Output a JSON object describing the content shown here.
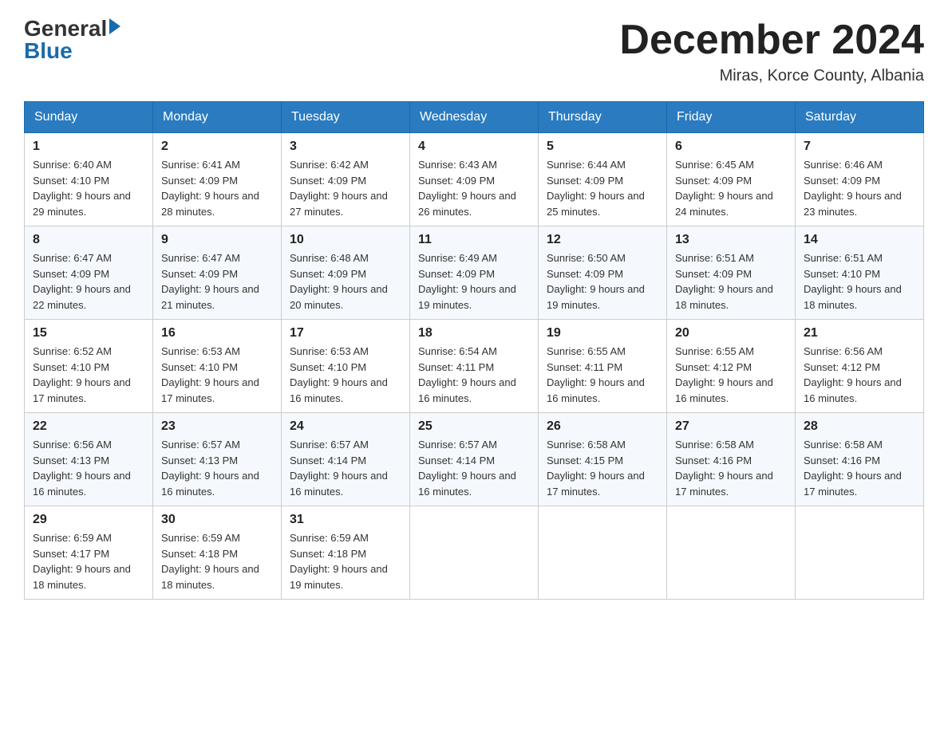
{
  "header": {
    "logo": {
      "general_text": "General",
      "blue_text": "Blue"
    },
    "title": "December 2024",
    "location": "Miras, Korce County, Albania"
  },
  "calendar": {
    "days_of_week": [
      "Sunday",
      "Monday",
      "Tuesday",
      "Wednesday",
      "Thursday",
      "Friday",
      "Saturday"
    ],
    "weeks": [
      [
        {
          "day": "1",
          "sunrise": "6:40 AM",
          "sunset": "4:10 PM",
          "daylight": "9 hours and 29 minutes."
        },
        {
          "day": "2",
          "sunrise": "6:41 AM",
          "sunset": "4:09 PM",
          "daylight": "9 hours and 28 minutes."
        },
        {
          "day": "3",
          "sunrise": "6:42 AM",
          "sunset": "4:09 PM",
          "daylight": "9 hours and 27 minutes."
        },
        {
          "day": "4",
          "sunrise": "6:43 AM",
          "sunset": "4:09 PM",
          "daylight": "9 hours and 26 minutes."
        },
        {
          "day": "5",
          "sunrise": "6:44 AM",
          "sunset": "4:09 PM",
          "daylight": "9 hours and 25 minutes."
        },
        {
          "day": "6",
          "sunrise": "6:45 AM",
          "sunset": "4:09 PM",
          "daylight": "9 hours and 24 minutes."
        },
        {
          "day": "7",
          "sunrise": "6:46 AM",
          "sunset": "4:09 PM",
          "daylight": "9 hours and 23 minutes."
        }
      ],
      [
        {
          "day": "8",
          "sunrise": "6:47 AM",
          "sunset": "4:09 PM",
          "daylight": "9 hours and 22 minutes."
        },
        {
          "day": "9",
          "sunrise": "6:47 AM",
          "sunset": "4:09 PM",
          "daylight": "9 hours and 21 minutes."
        },
        {
          "day": "10",
          "sunrise": "6:48 AM",
          "sunset": "4:09 PM",
          "daylight": "9 hours and 20 minutes."
        },
        {
          "day": "11",
          "sunrise": "6:49 AM",
          "sunset": "4:09 PM",
          "daylight": "9 hours and 19 minutes."
        },
        {
          "day": "12",
          "sunrise": "6:50 AM",
          "sunset": "4:09 PM",
          "daylight": "9 hours and 19 minutes."
        },
        {
          "day": "13",
          "sunrise": "6:51 AM",
          "sunset": "4:09 PM",
          "daylight": "9 hours and 18 minutes."
        },
        {
          "day": "14",
          "sunrise": "6:51 AM",
          "sunset": "4:10 PM",
          "daylight": "9 hours and 18 minutes."
        }
      ],
      [
        {
          "day": "15",
          "sunrise": "6:52 AM",
          "sunset": "4:10 PM",
          "daylight": "9 hours and 17 minutes."
        },
        {
          "day": "16",
          "sunrise": "6:53 AM",
          "sunset": "4:10 PM",
          "daylight": "9 hours and 17 minutes."
        },
        {
          "day": "17",
          "sunrise": "6:53 AM",
          "sunset": "4:10 PM",
          "daylight": "9 hours and 16 minutes."
        },
        {
          "day": "18",
          "sunrise": "6:54 AM",
          "sunset": "4:11 PM",
          "daylight": "9 hours and 16 minutes."
        },
        {
          "day": "19",
          "sunrise": "6:55 AM",
          "sunset": "4:11 PM",
          "daylight": "9 hours and 16 minutes."
        },
        {
          "day": "20",
          "sunrise": "6:55 AM",
          "sunset": "4:12 PM",
          "daylight": "9 hours and 16 minutes."
        },
        {
          "day": "21",
          "sunrise": "6:56 AM",
          "sunset": "4:12 PM",
          "daylight": "9 hours and 16 minutes."
        }
      ],
      [
        {
          "day": "22",
          "sunrise": "6:56 AM",
          "sunset": "4:13 PM",
          "daylight": "9 hours and 16 minutes."
        },
        {
          "day": "23",
          "sunrise": "6:57 AM",
          "sunset": "4:13 PM",
          "daylight": "9 hours and 16 minutes."
        },
        {
          "day": "24",
          "sunrise": "6:57 AM",
          "sunset": "4:14 PM",
          "daylight": "9 hours and 16 minutes."
        },
        {
          "day": "25",
          "sunrise": "6:57 AM",
          "sunset": "4:14 PM",
          "daylight": "9 hours and 16 minutes."
        },
        {
          "day": "26",
          "sunrise": "6:58 AM",
          "sunset": "4:15 PM",
          "daylight": "9 hours and 17 minutes."
        },
        {
          "day": "27",
          "sunrise": "6:58 AM",
          "sunset": "4:16 PM",
          "daylight": "9 hours and 17 minutes."
        },
        {
          "day": "28",
          "sunrise": "6:58 AM",
          "sunset": "4:16 PM",
          "daylight": "9 hours and 17 minutes."
        }
      ],
      [
        {
          "day": "29",
          "sunrise": "6:59 AM",
          "sunset": "4:17 PM",
          "daylight": "9 hours and 18 minutes."
        },
        {
          "day": "30",
          "sunrise": "6:59 AM",
          "sunset": "4:18 PM",
          "daylight": "9 hours and 18 minutes."
        },
        {
          "day": "31",
          "sunrise": "6:59 AM",
          "sunset": "4:18 PM",
          "daylight": "9 hours and 19 minutes."
        },
        null,
        null,
        null,
        null
      ]
    ]
  }
}
